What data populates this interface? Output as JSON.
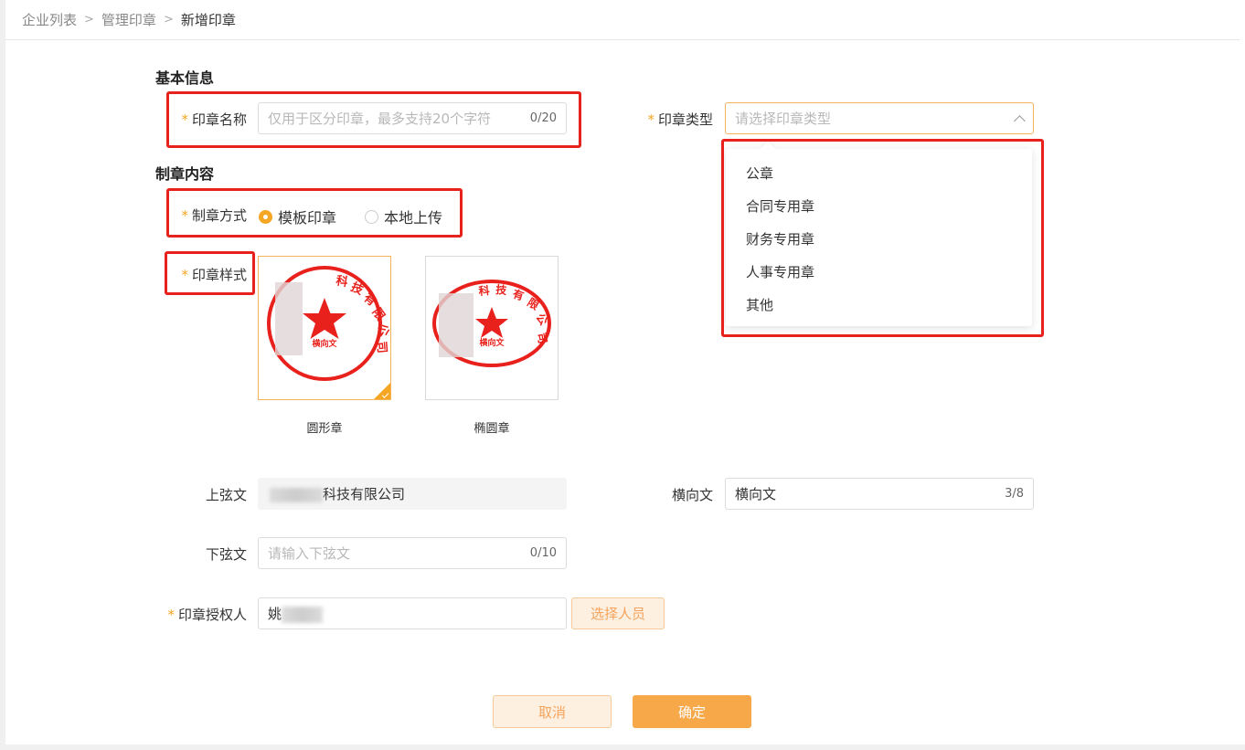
{
  "breadcrumb": [
    "企业列表",
    "管理印章",
    "新增印章"
  ],
  "sections": {
    "basic": "基本信息",
    "content": "制章内容"
  },
  "fields": {
    "name": {
      "label": "印章名称",
      "placeholder": "仅用于区分印章，最多支持20个字符",
      "count": "0/20"
    },
    "type": {
      "label": "印章类型",
      "placeholder": "请选择印章类型",
      "options": [
        "公章",
        "合同专用章",
        "财务专用章",
        "人事专用章",
        "其他"
      ]
    },
    "method": {
      "label": "制章方式",
      "options": [
        "模板印章",
        "本地上传"
      ],
      "selected": "模板印章"
    },
    "style": {
      "label": "印章样式",
      "options": [
        "圆形章",
        "椭圆章"
      ],
      "selected": "圆形章"
    },
    "upper": {
      "label": "上弦文",
      "value": "科技有限公司"
    },
    "horizontal": {
      "label": "横向文",
      "value": "横向文",
      "count": "3/8"
    },
    "lower": {
      "label": "下弦文",
      "placeholder": "请输入下弦文",
      "count": "0/10"
    },
    "authorizer": {
      "label": "印章授权人",
      "value": "姚",
      "button": "选择人员"
    }
  },
  "seal": {
    "top_text": "科技有限公司",
    "center_text": "横向文",
    "color": "#e8211c"
  },
  "actions": {
    "cancel": "取消",
    "confirm": "确定"
  },
  "colors": {
    "accent": "#f5a623",
    "highlight": "#e8211c"
  }
}
